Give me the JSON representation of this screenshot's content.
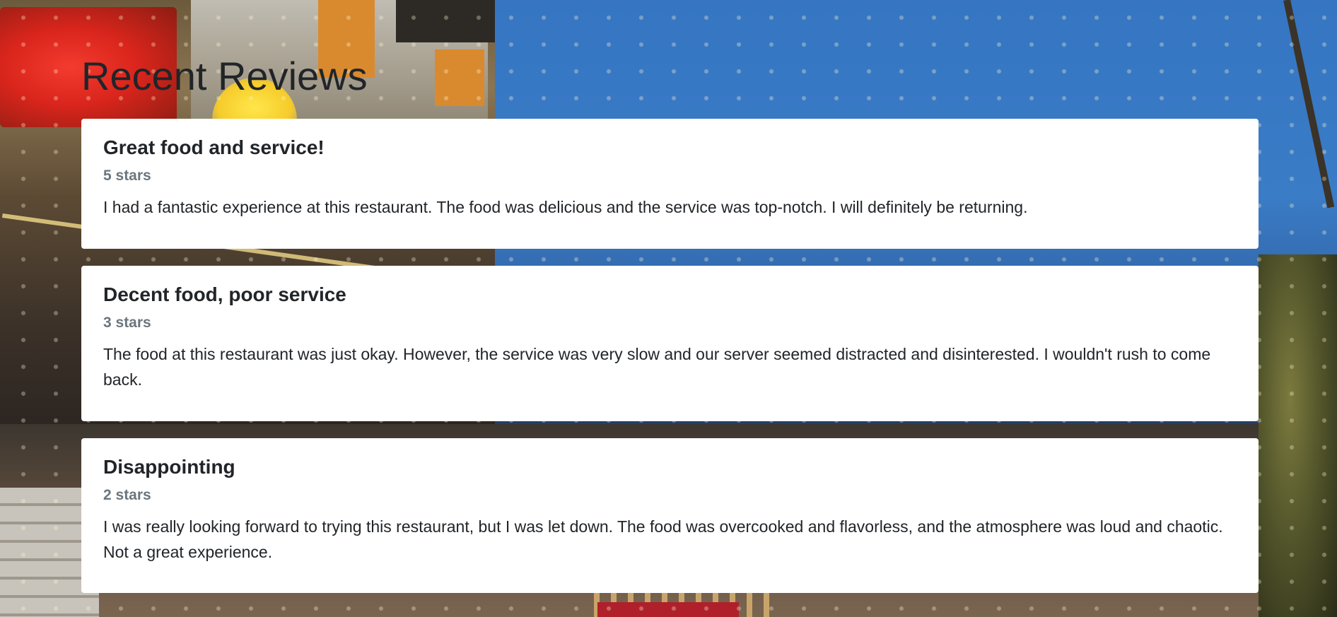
{
  "page": {
    "title": "Recent Reviews"
  },
  "reviews": [
    {
      "title": "Great food and service!",
      "rating": "5 stars",
      "text": "I had a fantastic experience at this restaurant. The food was delicious and the service was top-notch. I will definitely be returning."
    },
    {
      "title": "Decent food, poor service",
      "rating": "3 stars",
      "text": "The food at this restaurant was just okay. However, the service was very slow and our server seemed distracted and disinterested. I wouldn't rush to come back."
    },
    {
      "title": "Disappointing",
      "rating": "2 stars",
      "text": "I was really looking forward to trying this restaurant, but I was let down. The food was overcooked and flavorless, and the atmosphere was loud and chaotic. Not a great experience."
    }
  ],
  "colors": {
    "card_background": "#ffffff",
    "text_primary": "#212529",
    "text_muted": "#6c757d"
  }
}
